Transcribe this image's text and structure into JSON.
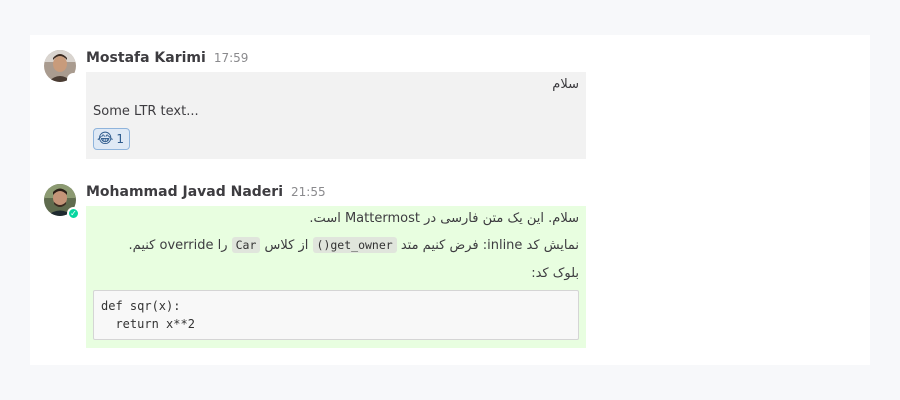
{
  "posts": [
    {
      "author": "Mostafa Karimi",
      "time": "17:59",
      "status": "offline",
      "avatar_icon": "user-avatar",
      "lines": {
        "rtl_1": "سلام",
        "ltr_1": "Some LTR text..."
      },
      "reaction": {
        "emoji": "😂",
        "count": "1"
      },
      "colors": {
        "background": "#f2f2f2"
      }
    },
    {
      "author": "Mohammad Javad Naderi",
      "time": "21:55",
      "status": "online",
      "avatar_icon": "user-avatar",
      "lines": {
        "rtl_1": "سلام. این یک متن فارسی در Mattermost است.",
        "rtl_2_part1": "نمایش کد inline: فرض کنیم متد ",
        "rtl_2_code1": "get_owner()",
        "rtl_2_part2": " از کلاس ",
        "rtl_2_code2": "Car",
        "rtl_2_part3": " را override کنیم.",
        "rtl_3": "بلوک کد:"
      },
      "code_block": "def sqr(x):\n  return x**2",
      "colors": {
        "background": "#e8fee0"
      }
    }
  ],
  "colors": {
    "page_background": "#f7f8fa",
    "panel_background": "#ffffff",
    "online_status": "#06d6a0",
    "reaction_border": "#8fb4dc"
  }
}
